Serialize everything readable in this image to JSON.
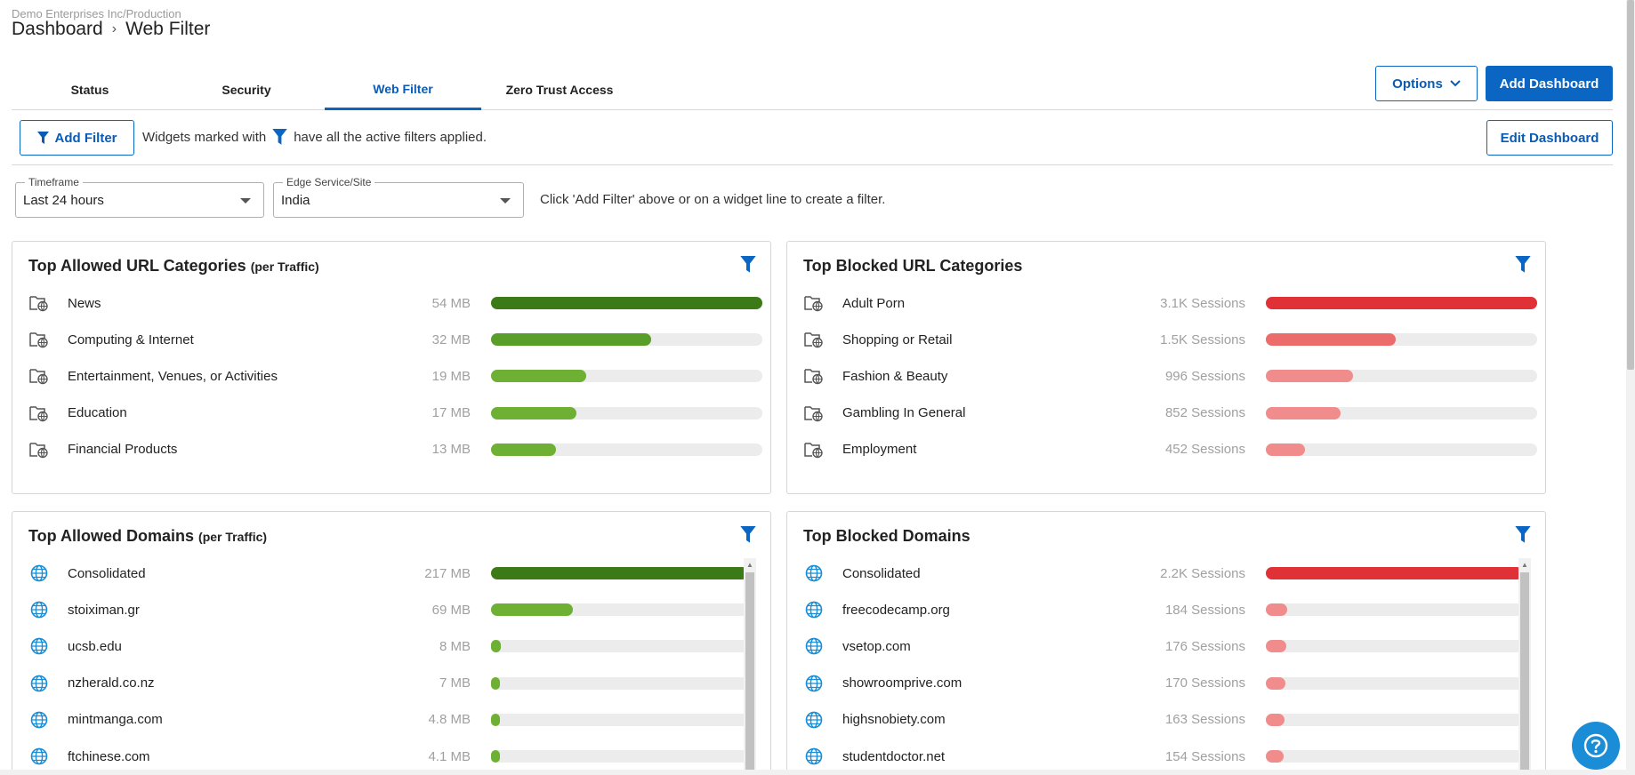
{
  "header": {
    "org_path": "Demo Enterprises Inc/Production",
    "breadcrumb_root": "Dashboard",
    "breadcrumb_sep": "›",
    "breadcrumb_current": "Web Filter"
  },
  "tabs": [
    {
      "label": "Status",
      "active": false
    },
    {
      "label": "Security",
      "active": false
    },
    {
      "label": "Web Filter",
      "active": true
    },
    {
      "label": "Zero Trust Access",
      "active": false
    }
  ],
  "toolbar": {
    "options_label": "Options",
    "add_dashboard_label": "Add Dashboard",
    "add_filter_label": "Add Filter",
    "edit_dashboard_label": "Edit Dashboard",
    "filter_note_prefix": "Widgets marked with",
    "filter_note_suffix": "have all the active filters applied."
  },
  "filters": {
    "timeframe_label": "Timeframe",
    "timeframe_value": "Last 24 hours",
    "site_label": "Edge Service/Site",
    "site_value": "India",
    "hint": "Click 'Add Filter' above or on a widget line to create a filter."
  },
  "colors": {
    "accent": "#0a66c2",
    "green_dark": "#3b7a17",
    "green_mid": "#5a9e2a",
    "green_light": "#6db033",
    "red": "#e03236",
    "red_mid": "#ec6b6b",
    "red_light": "#f08c8c",
    "bar_track": "#ececec"
  },
  "widgets": {
    "allowed_categories": {
      "title": "Top Allowed URL Categories",
      "subtitle": "(per Traffic)",
      "icon": "web-folder-icon",
      "rows": [
        {
          "name": "News",
          "amount": "54 MB",
          "fraction": 1.0,
          "color": "#3b7a17"
        },
        {
          "name": "Computing & Internet",
          "amount": "32 MB",
          "fraction": 0.59,
          "color": "#5a9e2a"
        },
        {
          "name": "Entertainment, Venues, or Activities",
          "amount": "19 MB",
          "fraction": 0.35,
          "color": "#6db033"
        },
        {
          "name": "Education",
          "amount": "17 MB",
          "fraction": 0.315,
          "color": "#6db033"
        },
        {
          "name": "Financial Products",
          "amount": "13 MB",
          "fraction": 0.24,
          "color": "#6db033"
        }
      ]
    },
    "blocked_categories": {
      "title": "Top Blocked URL Categories",
      "subtitle": "",
      "icon": "web-folder-icon",
      "rows": [
        {
          "name": "Adult Porn",
          "amount": "3.1K Sessions",
          "fraction": 1.0,
          "color": "#e03236"
        },
        {
          "name": "Shopping or Retail",
          "amount": "1.5K Sessions",
          "fraction": 0.48,
          "color": "#ec6b6b"
        },
        {
          "name": "Fashion & Beauty",
          "amount": "996 Sessions",
          "fraction": 0.32,
          "color": "#f08c8c"
        },
        {
          "name": "Gambling In General",
          "amount": "852 Sessions",
          "fraction": 0.275,
          "color": "#f08c8c"
        },
        {
          "name": "Employment",
          "amount": "452 Sessions",
          "fraction": 0.145,
          "color": "#f08c8c"
        }
      ]
    },
    "allowed_domains": {
      "title": "Top Allowed Domains",
      "subtitle": "(per Traffic)",
      "icon": "globe-icon",
      "rows": [
        {
          "name": "Consolidated",
          "amount": "217 MB",
          "fraction": 1.0,
          "color": "#3b7a17"
        },
        {
          "name": "stoiximan.gr",
          "amount": "69 MB",
          "fraction": 0.318,
          "color": "#6db033"
        },
        {
          "name": "ucsb.edu",
          "amount": "8 MB",
          "fraction": 0.037,
          "color": "#6db033"
        },
        {
          "name": "nzherald.co.nz",
          "amount": "7 MB",
          "fraction": 0.032,
          "color": "#6db033"
        },
        {
          "name": "mintmanga.com",
          "amount": "4.8 MB",
          "fraction": 0.022,
          "color": "#6db033"
        },
        {
          "name": "ftchinese.com",
          "amount": "4.1 MB",
          "fraction": 0.019,
          "color": "#6db033"
        }
      ]
    },
    "blocked_domains": {
      "title": "Top Blocked Domains",
      "subtitle": "",
      "icon": "globe-icon",
      "rows": [
        {
          "name": "Consolidated",
          "amount": "2.2K Sessions",
          "fraction": 1.0,
          "color": "#e03236"
        },
        {
          "name": "freecodecamp.org",
          "amount": "184 Sessions",
          "fraction": 0.084,
          "color": "#f08c8c"
        },
        {
          "name": "vsetop.com",
          "amount": "176 Sessions",
          "fraction": 0.08,
          "color": "#f08c8c"
        },
        {
          "name": "showroomprive.com",
          "amount": "170 Sessions",
          "fraction": 0.077,
          "color": "#f08c8c"
        },
        {
          "name": "highsnobiety.com",
          "amount": "163 Sessions",
          "fraction": 0.074,
          "color": "#f08c8c"
        },
        {
          "name": "studentdoctor.net",
          "amount": "154 Sessions",
          "fraction": 0.07,
          "color": "#f08c8c"
        }
      ]
    }
  },
  "help": {
    "icon": "help-icon"
  }
}
